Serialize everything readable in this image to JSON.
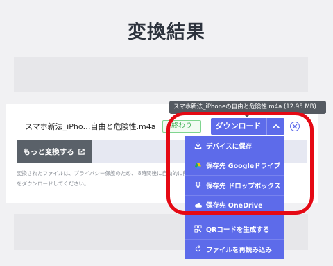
{
  "page": {
    "title": "変換結果"
  },
  "file": {
    "name": "スマホ新法_iPho…自由と危険性.m4a",
    "status": "終わり",
    "full_name_tooltip": "スマホ新法_iPhoneの自由と危険性.m4a (12.95 MB)"
  },
  "actions": {
    "download_label": "ダウンロード",
    "convert_more_label": "もっと変換する"
  },
  "notice": {
    "line1": "変換されたファイルは、プライバシー保護のため、 8時間後に自動的に削除されます。それまでにファイル",
    "line2": "をダウンロードしてください。"
  },
  "download_menu": {
    "items": [
      {
        "label": "デバイスに保存",
        "icon": "download-icon"
      },
      {
        "label": "保存先 Googleドライブ",
        "icon": "google-drive-icon"
      },
      {
        "label": "保存先 ドロップボックス",
        "icon": "dropbox-icon"
      },
      {
        "label": "保存先 OneDrive",
        "icon": "onedrive-icon"
      },
      {
        "label": "QRコードを生成する",
        "icon": "qr-code-icon"
      },
      {
        "label": "ファイルを再読み込み",
        "icon": "reload-icon"
      }
    ]
  },
  "colors": {
    "accent": "#5d6bea",
    "status_green": "#3cae52",
    "highlight_red": "#e50914",
    "convert_more_bg": "#5a6169"
  }
}
